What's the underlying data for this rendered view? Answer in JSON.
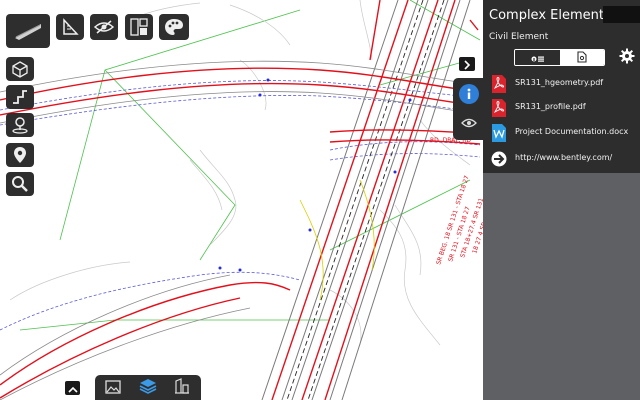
{
  "panel": {
    "title": "Complex Element:...",
    "subtitle": "Civil Element",
    "documents": [
      {
        "name": "SR131_hgeometry.pdf",
        "icon": "pdf-icon"
      },
      {
        "name": "SR131_profile.pdf",
        "icon": "pdf-icon"
      },
      {
        "name": "Project Documentation.docx",
        "icon": "word-icon"
      },
      {
        "name": "http://www.bentley.com/",
        "icon": "link-icon"
      }
    ]
  },
  "map": {
    "labels": [
      "RD, DRAY, RD",
      "SR 131 - STA 18 27",
      "SR BEG. 18 SR 131 - STA 18 27"
    ]
  },
  "colors": {
    "road_red": "#e3101c",
    "road_gray": "#888888",
    "panel_dark": "#2d2d2d",
    "panel_body": "#5f6063",
    "accent_blue": "#2f7ed8",
    "pdf_red": "#d9232d",
    "word_blue": "#2b9ae0"
  }
}
